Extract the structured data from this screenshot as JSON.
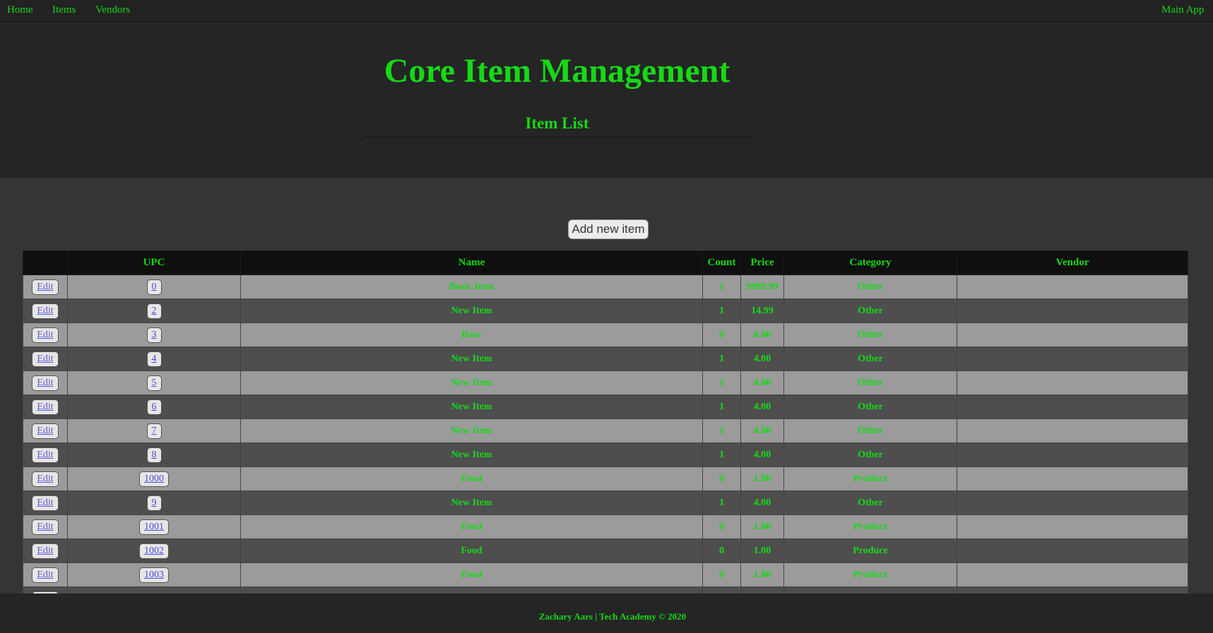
{
  "nav": {
    "home": "Home",
    "items": "Items",
    "vendors": "Vendors",
    "main_app": "Main App"
  },
  "header": {
    "title": "Core Item Management",
    "subtitle": "Item List"
  },
  "main": {
    "add_button": "Add new item"
  },
  "table": {
    "columns": [
      "",
      "UPC",
      "Name",
      "Count",
      "Price",
      "Category",
      "Vendor"
    ],
    "edit_label": "Edit",
    "rows": [
      {
        "upc": "0",
        "name": "Basic Item",
        "count": "1",
        "price": "9999.99",
        "category": "Other",
        "vendor": ""
      },
      {
        "upc": "2",
        "name": "New Item",
        "count": "1",
        "price": "14.99",
        "category": "Other",
        "vendor": ""
      },
      {
        "upc": "3",
        "name": "Base",
        "count": "0",
        "price": "0.00",
        "category": "Other",
        "vendor": ""
      },
      {
        "upc": "4",
        "name": "New Item",
        "count": "1",
        "price": "4.00",
        "category": "Other",
        "vendor": ""
      },
      {
        "upc": "5",
        "name": "New Item",
        "count": "1",
        "price": "4.00",
        "category": "Other",
        "vendor": ""
      },
      {
        "upc": "6",
        "name": "New Item",
        "count": "1",
        "price": "4.00",
        "category": "Other",
        "vendor": ""
      },
      {
        "upc": "7",
        "name": "New Item",
        "count": "1",
        "price": "4.00",
        "category": "Other",
        "vendor": ""
      },
      {
        "upc": "8",
        "name": "New Item",
        "count": "1",
        "price": "4.00",
        "category": "Other",
        "vendor": ""
      },
      {
        "upc": "1000",
        "name": "Food",
        "count": "0",
        "price": "1.00",
        "category": "Produce",
        "vendor": ""
      },
      {
        "upc": "9",
        "name": "New Item",
        "count": "1",
        "price": "4.00",
        "category": "Other",
        "vendor": ""
      },
      {
        "upc": "1001",
        "name": "Food",
        "count": "0",
        "price": "1.00",
        "category": "Produce",
        "vendor": ""
      },
      {
        "upc": "1002",
        "name": "Food",
        "count": "0",
        "price": "1.00",
        "category": "Produce",
        "vendor": ""
      },
      {
        "upc": "1003",
        "name": "Food",
        "count": "0",
        "price": "1.00",
        "category": "Produce",
        "vendor": ""
      },
      {
        "upc": "",
        "name": "",
        "count": "",
        "price": "",
        "category": "",
        "vendor": ""
      }
    ]
  },
  "footer": {
    "text": "Zachary Aars | Tech Academy © 2020"
  }
}
